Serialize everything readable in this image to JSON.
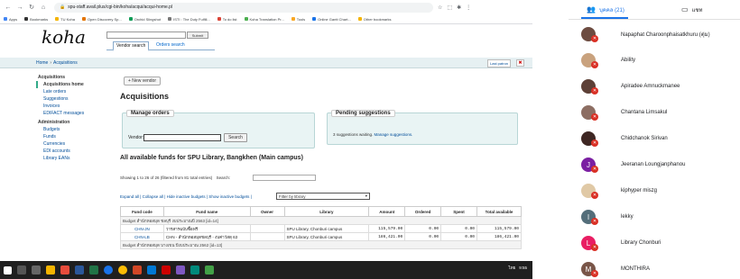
{
  "browser": {
    "url": "spu-staff.avail.plus/cgi-bin/koha/acqui/acqui-home.pl",
    "bookmarks": [
      "Apps",
      "Bookmarks",
      "TU Koha",
      "Open Discovery Sp...",
      "Orchid Slingshot",
      "ISTI : The Duty Fulfill...",
      "To do list",
      "Koha Translation Pr...",
      "Tools",
      "Online Gantt Chart...",
      "Other bookmarks"
    ]
  },
  "koha": {
    "logo": "koha",
    "vendor_search_button": "Submit",
    "tabs": [
      "Vendor search",
      "Orders search"
    ],
    "breadcrumb": [
      "Home",
      "Acquisitions"
    ],
    "last_patron": "Last patron",
    "sidebar": {
      "acquisitions_heading": "Acquisitions",
      "acquisitions_items": [
        "Acquisitions home",
        "Late orders",
        "Suggestions",
        "Invoices",
        "EDIFACT messages"
      ],
      "administration_heading": "Administration",
      "administration_items": [
        "Budgets",
        "Funds",
        "Currencies",
        "EDI accounts",
        "Library EANs"
      ]
    },
    "new_vendor": "+ New vendor",
    "page_title": "Acquisitions",
    "manage_orders": {
      "legend": "Manage orders",
      "vendor_label": "Vendor:",
      "search_button": "Search"
    },
    "pending": {
      "legend": "Pending suggestions",
      "text": "3 suggestions waiting.",
      "link": "Manage suggestions."
    },
    "funds_heading": "All available funds for SPU Library, Bangkhen (Main campus)",
    "showing": "Showing 1 to 26 of 26 (filtered from 81 total entries)",
    "search_label": "Search:",
    "expand_links": "Expand all | Collapse all | Hide inactive budgets | Show inactive budgets |",
    "filter_select": "Filter by library",
    "table": {
      "headers": [
        "Fund code",
        "Fund name",
        "Owner",
        "Library",
        "Amount",
        "Ordered",
        "Spent",
        "Total available"
      ],
      "group1": "Budget สำนักหอสมุด ชลบุรี งบประมาณปี 2563 [id=14]",
      "rows": [
        {
          "code": "CHN-JN",
          "name": "วารสารฉบับซื้อฟรี",
          "owner": "",
          "library": "SPU Library, Chonburi campus",
          "amount": "115,579.00",
          "ordered": "0.00",
          "spent": "0.00",
          "total": "115,579.00"
        },
        {
          "code": "CHN-LB",
          "name": "CHN - สำนักหอสมุดชลบุรี - งบค่าวัสดุ 63",
          "owner": "",
          "library": "SPU Library, Chonburi campus",
          "amount": "186,421.00",
          "ordered": "0.00",
          "spent": "0.00",
          "total": "186,421.00"
        }
      ],
      "group2": "Budget สำนักหอสมุด บางเขน ปีงบประมาณ 2562 [id=13]"
    }
  },
  "taskbar": {
    "lang": "ไทย",
    "time": "9:55"
  },
  "meet": {
    "people_tab": "บุคคล (21)",
    "chat_tab": "แชท",
    "participants": [
      {
        "name": "Napaphat Charoonphaisatkhuru (ตุ่ม)",
        "initial": "",
        "color": "#6d4c41"
      },
      {
        "name": "Ability",
        "initial": "",
        "color": "#c9a27e"
      },
      {
        "name": "Apiradee Amnuckmanee",
        "initial": "",
        "color": "#5d4037"
      },
      {
        "name": "Chantana Limsakul",
        "initial": "",
        "color": "#8d6e63"
      },
      {
        "name": "Chidchanok Sirivan",
        "initial": "",
        "color": "#3e2723"
      },
      {
        "name": "Jeeranan Loungjanphanou",
        "initial": "J",
        "color": "#7b1fa2"
      },
      {
        "name": "kiphyper miszg",
        "initial": "",
        "color": "#e0c9a6"
      },
      {
        "name": "lekky",
        "initial": "l",
        "color": "#546e7a"
      },
      {
        "name": "Library Chonburi",
        "initial": "L",
        "color": "#e91e63"
      },
      {
        "name": "MONTHIRA",
        "initial": "M",
        "color": "#795548"
      }
    ]
  }
}
